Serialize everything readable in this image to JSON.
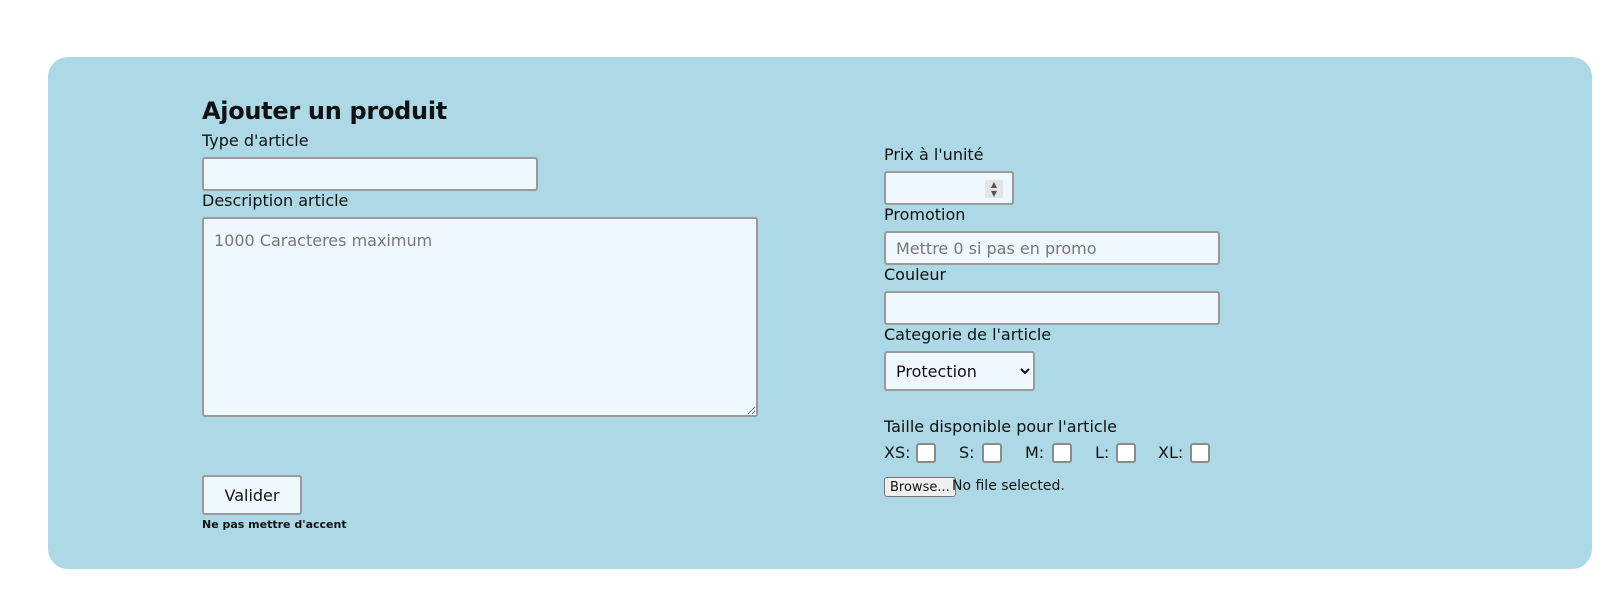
{
  "form": {
    "title": "Ajouter un produit",
    "type_label": "Type d'article",
    "type_value": "",
    "description_label": "Description article",
    "description_placeholder": "1000 Caracteres maximum",
    "price_label": "Prix à l'unité",
    "price_value": "",
    "promo_label": "Promotion",
    "promo_placeholder": "Mettre 0 si pas en promo",
    "color_label": "Couleur",
    "color_value": "",
    "category_label": "Categorie de l'article",
    "category_selected": "Protection",
    "sizes_label": "Taille disponible pour l'article",
    "sizes": [
      {
        "label": "XS:",
        "checked": false
      },
      {
        "label": "S:",
        "checked": false
      },
      {
        "label": "M:",
        "checked": false
      },
      {
        "label": "L:",
        "checked": false
      },
      {
        "label": "XL:",
        "checked": false
      }
    ],
    "file_button": "Browse...",
    "file_status": "No file selected.",
    "submit_label": "Valider",
    "accent_note": "Ne pas mettre d'accent"
  },
  "colors": {
    "panel": "#add8e6",
    "field": "#f0f8ff"
  }
}
